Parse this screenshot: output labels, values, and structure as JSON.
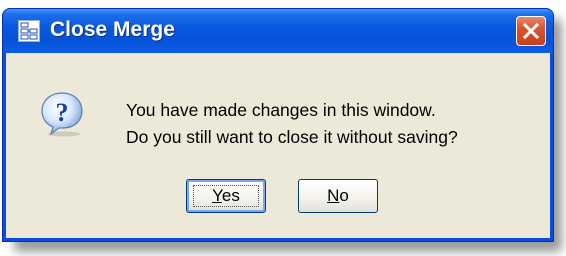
{
  "dialog": {
    "title": "Close Merge",
    "app_icon": "merge-app-icon",
    "close_icon": "close-x-icon",
    "message_icon": "question-icon",
    "message_lines": [
      "You have made changes in this window.",
      "Do you still want to close it without saving?"
    ],
    "buttons": {
      "yes": {
        "mnemonic": "Y",
        "rest": "es"
      },
      "no": {
        "mnemonic": "N",
        "rest": "o"
      }
    }
  },
  "colors": {
    "titlebar": "#0653d8",
    "body": "#ece9d8",
    "close_button": "#d9552f"
  }
}
